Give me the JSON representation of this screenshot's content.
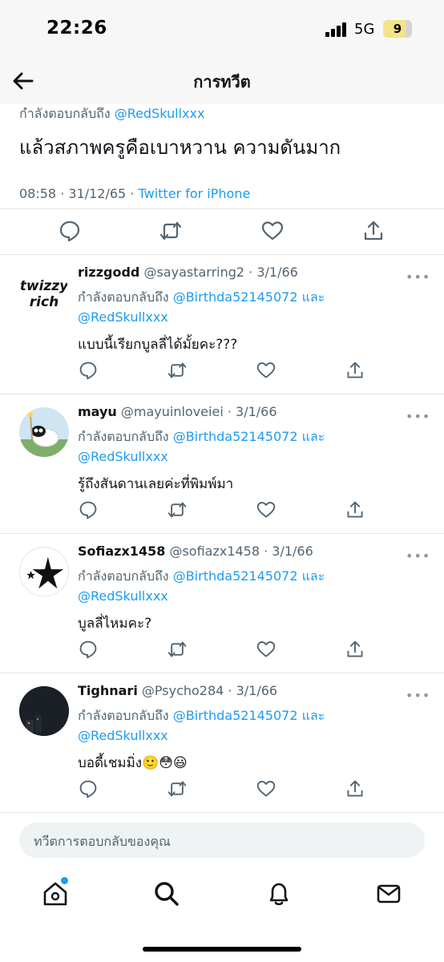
{
  "status_bar": {
    "time": "22:26",
    "network": "5G",
    "battery": "9"
  },
  "nav": {
    "title": "การทวีต",
    "back_icon": "arrow-left-icon"
  },
  "main_tweet": {
    "reply_prefix": "กำลังตอบกลับถึง ",
    "reply_to": "@RedSkullxxx",
    "text": "แล้วสภาพครูคือเบาหวาน ความดันมาก",
    "datetime": "08:58 · 31/12/65 · ",
    "source": "Twitter for iPhone",
    "actions": [
      "reply-icon",
      "retweet-icon",
      "like-icon",
      "share-icon"
    ]
  },
  "replies": [
    {
      "name": "rizzgodd",
      "handle": "@sayastarring2 · 3/1/66",
      "reply_prefix": "กำลังตอบกลับถึง ",
      "reply_to_1": "@Birthda52145072",
      "reply_and": " และ",
      "reply_to_2": "@RedSkullxxx",
      "text": "แบบนี้เรียกบูลลี่ได้มั้ยคะ???",
      "avatar_text": "twizzy rich"
    },
    {
      "name": "mayu",
      "handle": "@mayuinloveiei · 3/1/66",
      "reply_prefix": "กำลังตอบกลับถึง ",
      "reply_to_1": "@Birthda52145072",
      "reply_and": " และ",
      "reply_to_2": "@RedSkullxxx",
      "text": "รู้ถึงสันดานเลยค่ะที่พิมพ์มา"
    },
    {
      "name": "Sofiazx1458",
      "handle": "@sofiazx1458 · 3/1/66",
      "reply_prefix": "กำลังตอบกลับถึง ",
      "reply_to_1": "@Birthda52145072",
      "reply_and": " และ",
      "reply_to_2": "@RedSkullxxx",
      "text": "บูลลี่ไหมคะ?"
    },
    {
      "name": "Tighnari",
      "handle": "@Psycho284 · 3/1/66",
      "reply_prefix": "กำลังตอบกลับถึง ",
      "reply_to_1": "@Birthda52145072",
      "reply_and": " และ",
      "reply_to_2": "@RedSkullxxx",
      "text": "บอดี้เชมมิ่ง🙂😳😃"
    }
  ],
  "composer": {
    "placeholder": "ทวีตการตอบกลับของคุณ"
  },
  "tab_bar": [
    "home-icon",
    "search-icon",
    "notifications-icon",
    "messages-icon"
  ],
  "colors": {
    "accent": "#1d9bf0",
    "secondary_text": "#536471"
  }
}
